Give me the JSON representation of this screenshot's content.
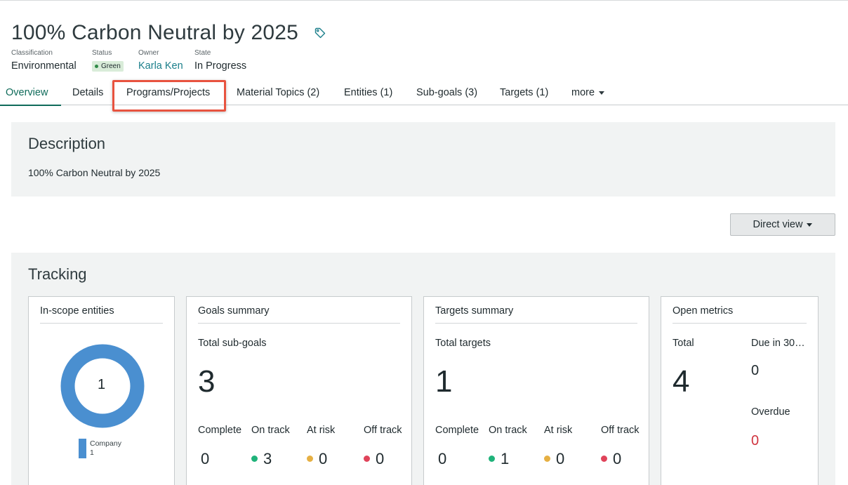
{
  "header": {
    "title": "100% Carbon Neutral by 2025",
    "tag_icon": "tag-icon"
  },
  "meta": {
    "classification": {
      "label": "Classification",
      "value": "Environmental"
    },
    "status": {
      "label": "Status",
      "value": "Green",
      "color": "#2f8a47"
    },
    "owner": {
      "label": "Owner",
      "value": "Karla Ken"
    },
    "state": {
      "label": "State",
      "value": "In Progress"
    }
  },
  "tabs": [
    {
      "label": "Overview",
      "active": true
    },
    {
      "label": "Details"
    },
    {
      "label": "Programs/Projects",
      "highlighted": true
    },
    {
      "label": "Material Topics (2)"
    },
    {
      "label": "Entities (1)"
    },
    {
      "label": "Sub-goals (3)"
    },
    {
      "label": "Targets (1)"
    },
    {
      "label": "more"
    }
  ],
  "description": {
    "title": "Description",
    "text": "100% Carbon Neutral by 2025"
  },
  "view_button": {
    "label": "Direct view"
  },
  "tracking": {
    "title": "Tracking",
    "entities": {
      "title": "In-scope entities",
      "donut_center": "1",
      "legend": [
        {
          "name": "Company",
          "value": "1",
          "color": "#4a8fd0"
        }
      ]
    },
    "goals": {
      "title": "Goals summary",
      "total_label": "Total sub-goals",
      "total": "3",
      "complete_label": "Complete",
      "complete": "0",
      "on_track_label": "On track",
      "on_track": "3",
      "at_risk_label": "At risk",
      "at_risk": "0",
      "off_track_label": "Off track",
      "off_track": "0"
    },
    "targets": {
      "title": "Targets summary",
      "total_label": "Total targets",
      "total": "1",
      "complete_label": "Complete",
      "complete": "0",
      "on_track_label": "On track",
      "on_track": "1",
      "at_risk_label": "At risk",
      "at_risk": "0",
      "off_track_label": "Off track",
      "off_track": "0"
    },
    "metrics": {
      "title": "Open metrics",
      "total_label": "Total",
      "total": "4",
      "due_label": "Due in 30…",
      "due": "0",
      "overdue_label": "Overdue",
      "overdue": "0"
    },
    "status_colors": {
      "on_track": "#1fb37a",
      "at_risk": "#e6b043",
      "off_track": "#e0435a",
      "overdue": "#d0343f"
    }
  }
}
